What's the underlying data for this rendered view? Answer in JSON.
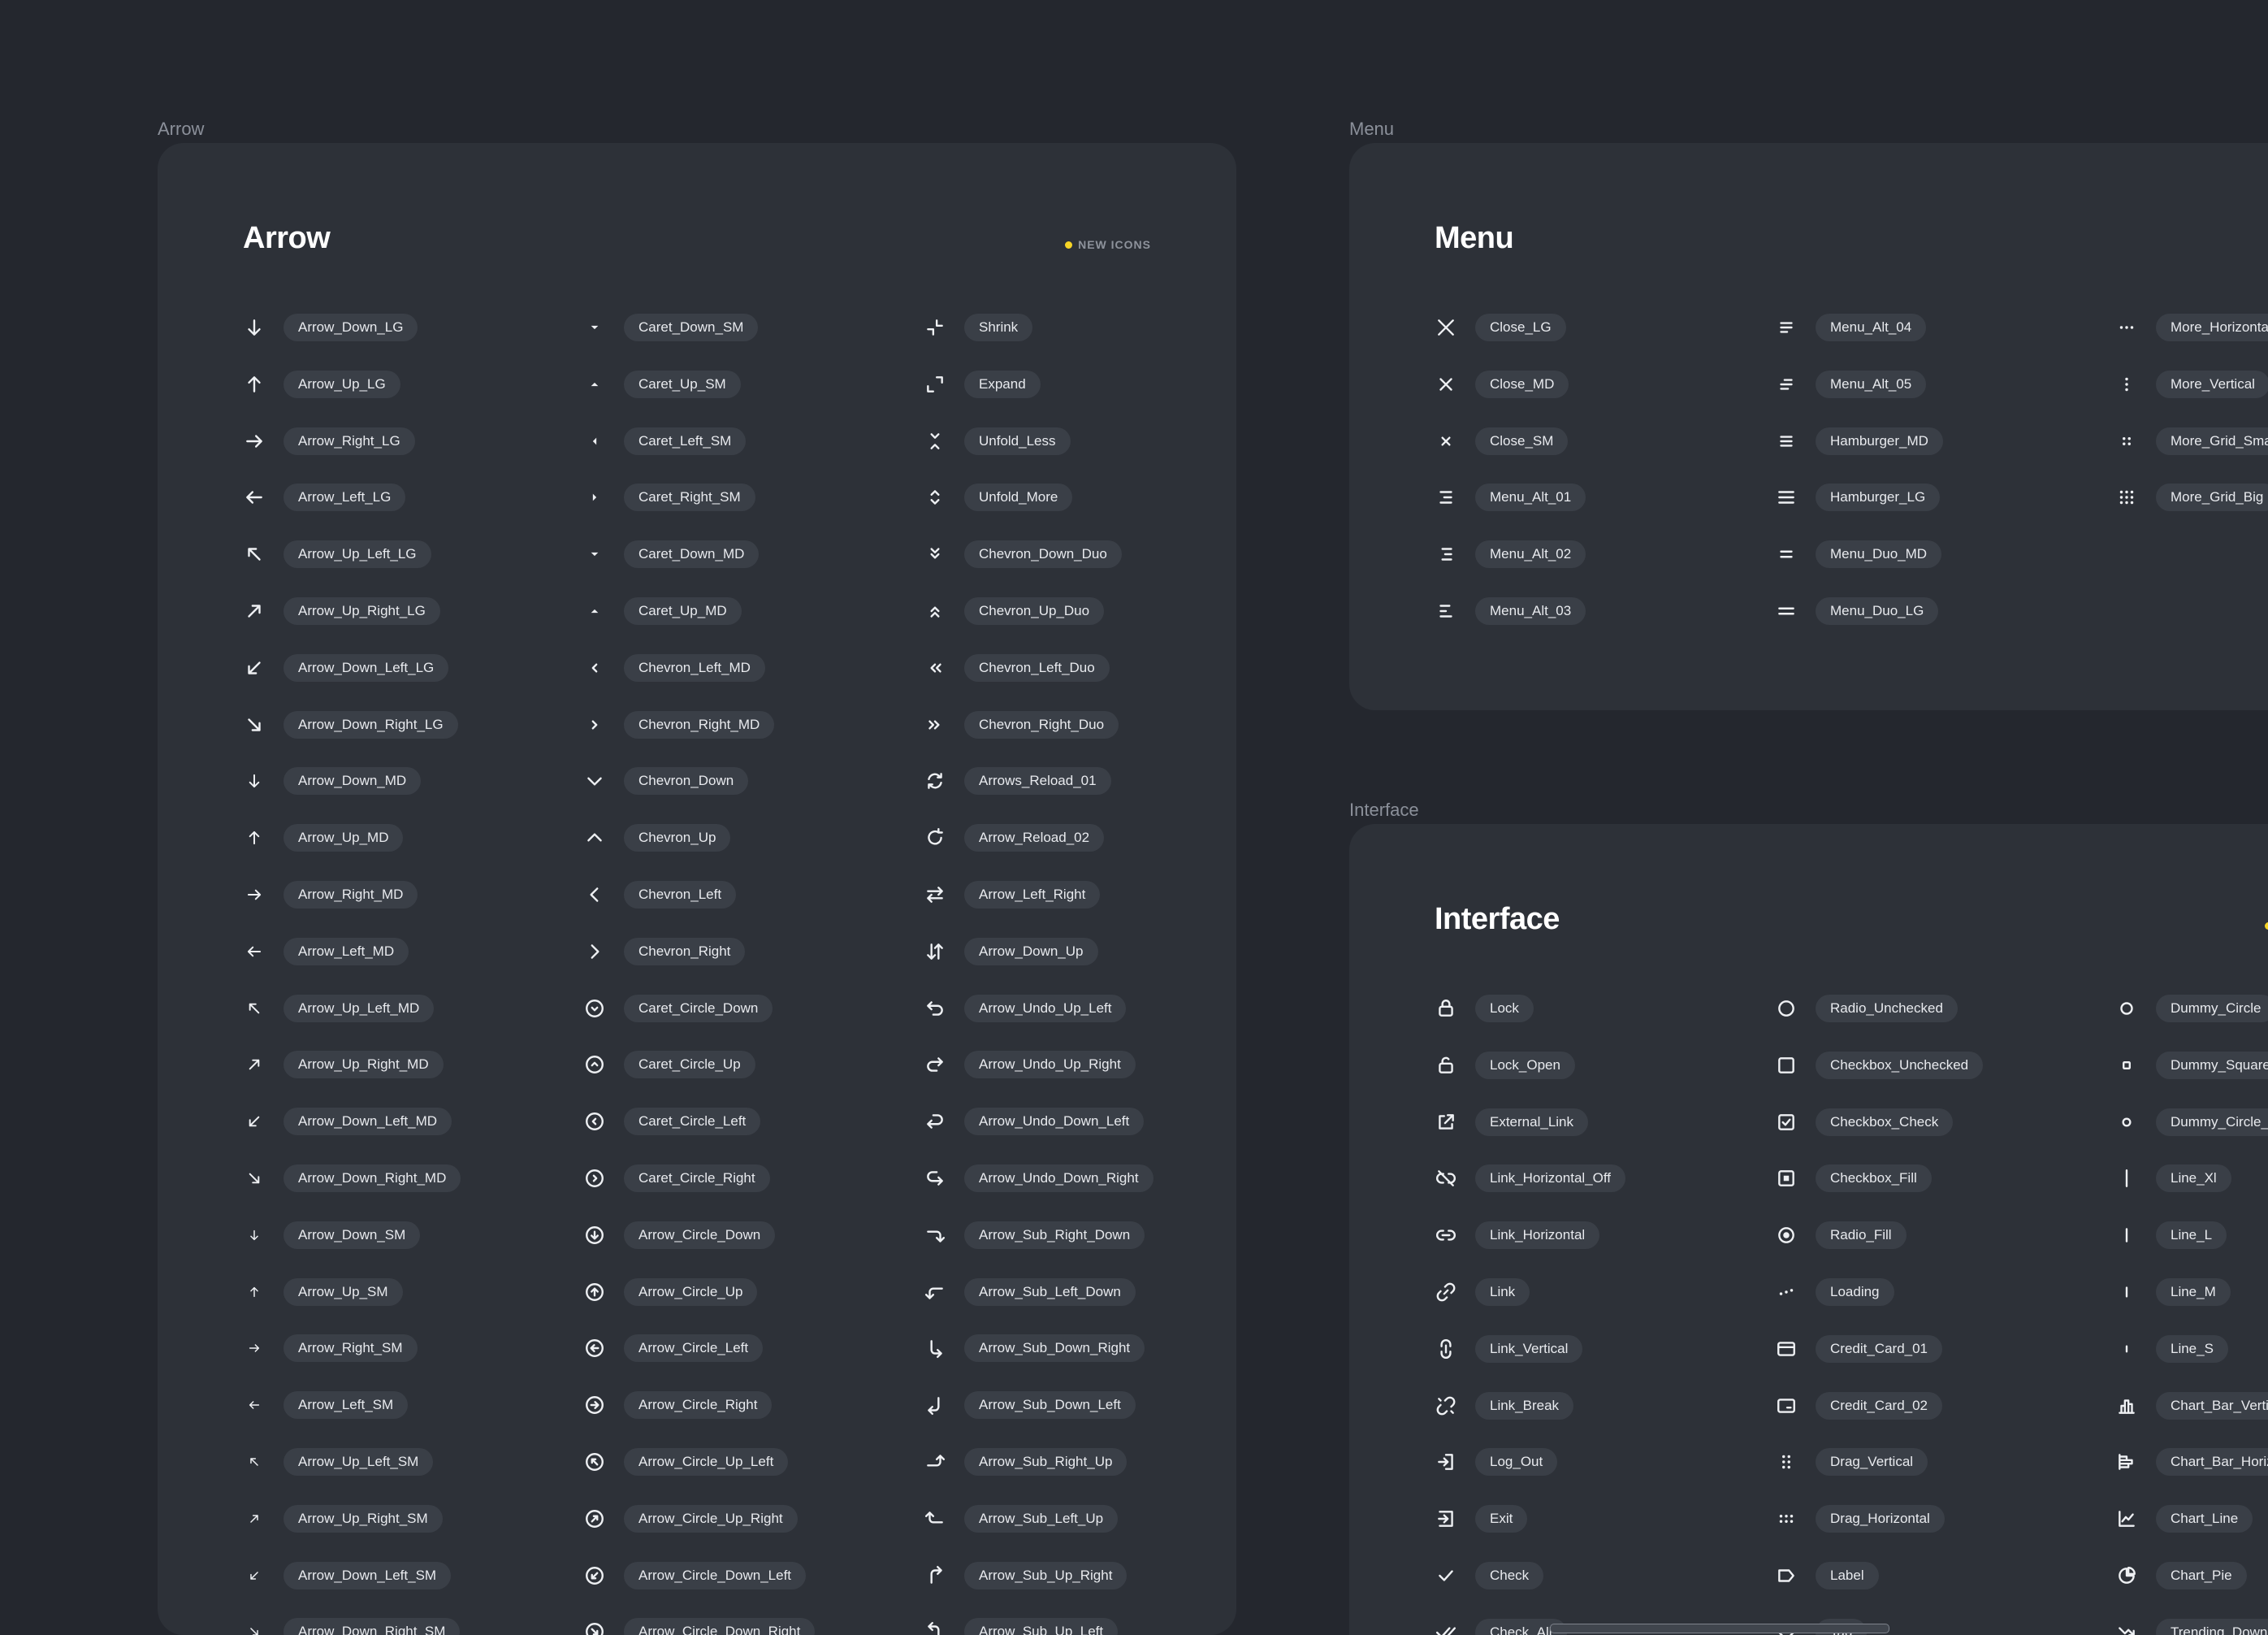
{
  "colors": {
    "background": "#24272e",
    "card": "#2d3138",
    "pill": "#3a3f47",
    "badge_dot": "#f6d426",
    "text": "#e9ebef"
  },
  "frames": [
    {
      "key": "arrow",
      "frame_label": "Arrow",
      "title": "Arrow",
      "badge": "NEW ICONS",
      "columns": [
        [
          {
            "label": "Arrow_Down_LG",
            "icon": "arrow-down-lg-icon"
          },
          {
            "label": "Arrow_Up_LG",
            "icon": "arrow-up-lg-icon"
          },
          {
            "label": "Arrow_Right_LG",
            "icon": "arrow-right-lg-icon"
          },
          {
            "label": "Arrow_Left_LG",
            "icon": "arrow-left-lg-icon"
          },
          {
            "label": "Arrow_Up_Left_LG",
            "icon": "arrow-up-left-lg-icon"
          },
          {
            "label": "Arrow_Up_Right_LG",
            "icon": "arrow-up-right-lg-icon"
          },
          {
            "label": "Arrow_Down_Left_LG",
            "icon": "arrow-down-left-lg-icon"
          },
          {
            "label": "Arrow_Down_Right_LG",
            "icon": "arrow-down-right-lg-icon"
          },
          {
            "label": "Arrow_Down_MD",
            "icon": "arrow-down-md-icon"
          },
          {
            "label": "Arrow_Up_MD",
            "icon": "arrow-up-md-icon"
          },
          {
            "label": "Arrow_Right_MD",
            "icon": "arrow-right-md-icon"
          },
          {
            "label": "Arrow_Left_MD",
            "icon": "arrow-left-md-icon"
          },
          {
            "label": "Arrow_Up_Left_MD",
            "icon": "arrow-up-left-md-icon"
          },
          {
            "label": "Arrow_Up_Right_MD",
            "icon": "arrow-up-right-md-icon"
          },
          {
            "label": "Arrow_Down_Left_MD",
            "icon": "arrow-down-left-md-icon"
          },
          {
            "label": "Arrow_Down_Right_MD",
            "icon": "arrow-down-right-md-icon"
          },
          {
            "label": "Arrow_Down_SM",
            "icon": "arrow-down-sm-icon"
          },
          {
            "label": "Arrow_Up_SM",
            "icon": "arrow-up-sm-icon"
          },
          {
            "label": "Arrow_Right_SM",
            "icon": "arrow-right-sm-icon"
          },
          {
            "label": "Arrow_Left_SM",
            "icon": "arrow-left-sm-icon"
          },
          {
            "label": "Arrow_Up_Left_SM",
            "icon": "arrow-up-left-sm-icon"
          },
          {
            "label": "Arrow_Up_Right_SM",
            "icon": "arrow-up-right-sm-icon"
          },
          {
            "label": "Arrow_Down_Left_SM",
            "icon": "arrow-down-left-sm-icon"
          },
          {
            "label": "Arrow_Down_Right_SM",
            "icon": "arrow-down-right-sm-icon"
          }
        ],
        [
          {
            "label": "Caret_Down_SM",
            "icon": "caret-down-sm-icon"
          },
          {
            "label": "Caret_Up_SM",
            "icon": "caret-up-sm-icon"
          },
          {
            "label": "Caret_Left_SM",
            "icon": "caret-left-sm-icon"
          },
          {
            "label": "Caret_Right_SM",
            "icon": "caret-right-sm-icon"
          },
          {
            "label": "Caret_Down_MD",
            "icon": "caret-down-md-icon"
          },
          {
            "label": "Caret_Up_MD",
            "icon": "caret-up-md-icon"
          },
          {
            "label": "Chevron_Left_MD",
            "icon": "chevron-left-md-icon"
          },
          {
            "label": "Chevron_Right_MD",
            "icon": "chevron-right-md-icon"
          },
          {
            "label": "Chevron_Down",
            "icon": "chevron-down-icon"
          },
          {
            "label": "Chevron_Up",
            "icon": "chevron-up-icon"
          },
          {
            "label": "Chevron_Left",
            "icon": "chevron-left-icon"
          },
          {
            "label": "Chevron_Right",
            "icon": "chevron-right-icon"
          },
          {
            "label": "Caret_Circle_Down",
            "icon": "caret-circle-down-icon"
          },
          {
            "label": "Caret_Circle_Up",
            "icon": "caret-circle-up-icon"
          },
          {
            "label": "Caret_Circle_Left",
            "icon": "caret-circle-left-icon"
          },
          {
            "label": "Caret_Circle_Right",
            "icon": "caret-circle-right-icon"
          },
          {
            "label": "Arrow_Circle_Down",
            "icon": "arrow-circle-down-icon"
          },
          {
            "label": "Arrow_Circle_Up",
            "icon": "arrow-circle-up-icon"
          },
          {
            "label": "Arrow_Circle_Left",
            "icon": "arrow-circle-left-icon"
          },
          {
            "label": "Arrow_Circle_Right",
            "icon": "arrow-circle-right-icon"
          },
          {
            "label": "Arrow_Circle_Up_Left",
            "icon": "arrow-circle-up-left-icon"
          },
          {
            "label": "Arrow_Circle_Up_Right",
            "icon": "arrow-circle-up-right-icon"
          },
          {
            "label": "Arrow_Circle_Down_Left",
            "icon": "arrow-circle-down-left-icon"
          },
          {
            "label": "Arrow_Circle_Down_Right",
            "icon": "arrow-circle-down-right-icon"
          }
        ],
        [
          {
            "label": "Shrink",
            "icon": "shrink-icon"
          },
          {
            "label": "Expand",
            "icon": "expand-icon"
          },
          {
            "label": "Unfold_Less",
            "icon": "unfold-less-icon"
          },
          {
            "label": "Unfold_More",
            "icon": "unfold-more-icon"
          },
          {
            "label": "Chevron_Down_Duo",
            "icon": "chevron-down-duo-icon"
          },
          {
            "label": "Chevron_Up_Duo",
            "icon": "chevron-up-duo-icon"
          },
          {
            "label": "Chevron_Left_Duo",
            "icon": "chevron-left-duo-icon"
          },
          {
            "label": "Chevron_Right_Duo",
            "icon": "chevron-right-duo-icon"
          },
          {
            "label": "Arrows_Reload_01",
            "icon": "arrows-reload-icon"
          },
          {
            "label": "Arrow_Reload_02",
            "icon": "arrow-reload-icon"
          },
          {
            "label": "Arrow_Left_Right",
            "icon": "arrow-left-right-icon"
          },
          {
            "label": "Arrow_Down_Up",
            "icon": "arrow-down-up-icon"
          },
          {
            "label": "Arrow_Undo_Up_Left",
            "icon": "arrow-undo-up-left-icon"
          },
          {
            "label": "Arrow_Undo_Up_Right",
            "icon": "arrow-undo-up-right-icon"
          },
          {
            "label": "Arrow_Undo_Down_Left",
            "icon": "arrow-undo-down-left-icon"
          },
          {
            "label": "Arrow_Undo_Down_Right",
            "icon": "arrow-undo-down-right-icon"
          },
          {
            "label": "Arrow_Sub_Right_Down",
            "icon": "arrow-sub-right-down-icon"
          },
          {
            "label": "Arrow_Sub_Left_Down",
            "icon": "arrow-sub-left-down-icon"
          },
          {
            "label": "Arrow_Sub_Down_Right",
            "icon": "arrow-sub-down-right-icon"
          },
          {
            "label": "Arrow_Sub_Down_Left",
            "icon": "arrow-sub-down-left-icon"
          },
          {
            "label": "Arrow_Sub_Right_Up",
            "icon": "arrow-sub-right-up-icon"
          },
          {
            "label": "Arrow_Sub_Left_Up",
            "icon": "arrow-sub-left-up-icon"
          },
          {
            "label": "Arrow_Sub_Up_Right",
            "icon": "arrow-sub-up-right-icon"
          },
          {
            "label": "Arrow_Sub_Up_Left",
            "icon": "arrow-sub-up-left-icon"
          }
        ]
      ]
    },
    {
      "key": "menu",
      "frame_label": "Menu",
      "title": "Menu",
      "badge": "",
      "columns": [
        [
          {
            "label": "Close_LG",
            "icon": "close-lg-icon"
          },
          {
            "label": "Close_MD",
            "icon": "close-md-icon"
          },
          {
            "label": "Close_SM",
            "icon": "close-sm-icon"
          },
          {
            "label": "Menu_Alt_01",
            "icon": "menu-alt-01-icon"
          },
          {
            "label": "Menu_Alt_02",
            "icon": "menu-alt-02-icon"
          },
          {
            "label": "Menu_Alt_03",
            "icon": "menu-alt-03-icon"
          }
        ],
        [
          {
            "label": "Menu_Alt_04",
            "icon": "menu-alt-04-icon"
          },
          {
            "label": "Menu_Alt_05",
            "icon": "menu-alt-05-icon"
          },
          {
            "label": "Hamburger_MD",
            "icon": "hamburger-md-icon"
          },
          {
            "label": "Hamburger_LG",
            "icon": "hamburger-lg-icon"
          },
          {
            "label": "Menu_Duo_MD",
            "icon": "menu-duo-md-icon"
          },
          {
            "label": "Menu_Duo_LG",
            "icon": "menu-duo-lg-icon"
          }
        ],
        [
          {
            "label": "More_Horizontal",
            "icon": "more-horizontal-icon"
          },
          {
            "label": "More_Vertical",
            "icon": "more-vertical-icon"
          },
          {
            "label": "More_Grid_Small",
            "icon": "more-grid-small-icon"
          },
          {
            "label": "More_Grid_Big",
            "icon": "more-grid-big-icon"
          }
        ]
      ]
    },
    {
      "key": "interface",
      "frame_label": "Interface",
      "title": "Interface",
      "badge": "",
      "columns": [
        [
          {
            "label": "Lock",
            "icon": "lock-icon"
          },
          {
            "label": "Lock_Open",
            "icon": "lock-open-icon"
          },
          {
            "label": "External_Link",
            "icon": "external-link-icon"
          },
          {
            "label": "Link_Horizontal_Off",
            "icon": "link-horizontal-off-icon"
          },
          {
            "label": "Link_Horizontal",
            "icon": "link-horizontal-icon"
          },
          {
            "label": "Link",
            "icon": "link-icon"
          },
          {
            "label": "Link_Vertical",
            "icon": "link-vertical-icon"
          },
          {
            "label": "Link_Break",
            "icon": "link-break-icon"
          },
          {
            "label": "Log_Out",
            "icon": "log-out-icon"
          },
          {
            "label": "Exit",
            "icon": "exit-icon"
          },
          {
            "label": "Check",
            "icon": "check-icon"
          },
          {
            "label": "Check_All",
            "icon": "check-all-icon"
          }
        ],
        [
          {
            "label": "Radio_Unchecked",
            "icon": "radio-unchecked-icon"
          },
          {
            "label": "Checkbox_Unchecked",
            "icon": "checkbox-unchecked-icon"
          },
          {
            "label": "Checkbox_Check",
            "icon": "checkbox-check-icon"
          },
          {
            "label": "Checkbox_Fill",
            "icon": "checkbox-fill-icon"
          },
          {
            "label": "Radio_Fill",
            "icon": "radio-fill-icon"
          },
          {
            "label": "Loading",
            "icon": "loading-icon"
          },
          {
            "label": "Credit_Card_01",
            "icon": "credit-card-01-icon"
          },
          {
            "label": "Credit_Card_02",
            "icon": "credit-card-02-icon"
          },
          {
            "label": "Drag_Vertical",
            "icon": "drag-vertical-icon"
          },
          {
            "label": "Drag_Horizontal",
            "icon": "drag-horizontal-icon"
          },
          {
            "label": "Label",
            "icon": "label-icon"
          },
          {
            "label": "Tag",
            "icon": "tag-icon"
          }
        ],
        [
          {
            "label": "Dummy_Circle",
            "icon": "dummy-circle-icon"
          },
          {
            "label": "Dummy_Square",
            "icon": "dummy-square-icon"
          },
          {
            "label": "Dummy_Circle_Small",
            "icon": "dummy-circle-small-icon"
          },
          {
            "label": "Line_Xl",
            "icon": "line-xl-icon"
          },
          {
            "label": "Line_L",
            "icon": "line-l-icon"
          },
          {
            "label": "Line_M",
            "icon": "line-m-icon"
          },
          {
            "label": "Line_S",
            "icon": "line-s-icon"
          },
          {
            "label": "Chart_Bar_Vertical",
            "icon": "chart-bar-vertical-icon"
          },
          {
            "label": "Chart_Bar_Horizontal",
            "icon": "chart-bar-horizontal-icon"
          },
          {
            "label": "Chart_Line",
            "icon": "chart-line-icon"
          },
          {
            "label": "Chart_Pie",
            "icon": "chart-pie-icon"
          },
          {
            "label": "Trending_Down",
            "icon": "trending-down-icon"
          }
        ]
      ]
    }
  ]
}
